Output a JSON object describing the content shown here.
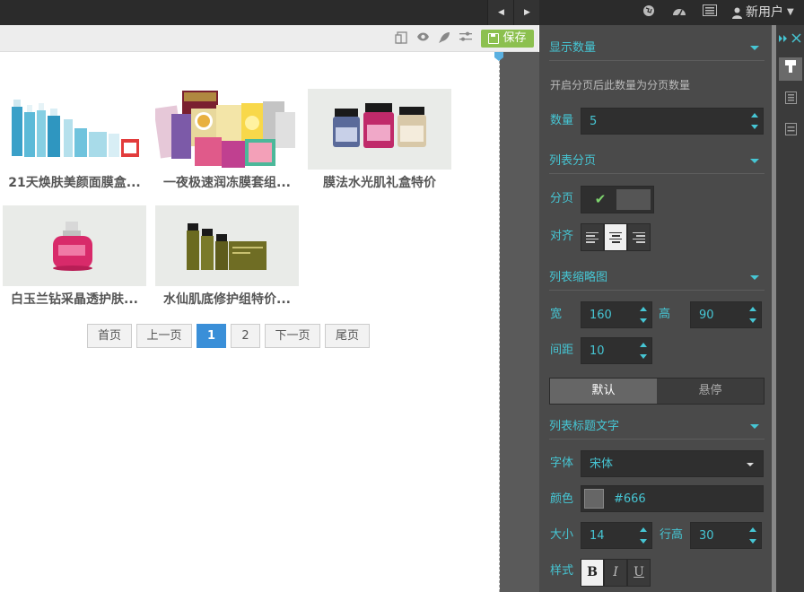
{
  "topbar": {
    "user_label": "新用户",
    "icons": [
      "globe-icon",
      "dashboard-icon",
      "list-icon",
      "user-icon"
    ]
  },
  "toolbar": {
    "icons": [
      "copy-icon",
      "preview-icon",
      "publish-icon",
      "settings-icon"
    ],
    "save_label": "保存"
  },
  "products": [
    {
      "title": "21天焕肤美颜面膜盒...",
      "image": "skincare-bottles-image"
    },
    {
      "title": "一夜极速润冻膜套组...",
      "image": "face-mask-packets-image"
    },
    {
      "title": "膜法水光肌礼盒特价",
      "image": "serum-jars-image"
    },
    {
      "title": "白玉兰钻采晶透护肤...",
      "image": "pink-perfume-bottle-image"
    },
    {
      "title": "水仙肌底修护组特价...",
      "image": "olive-skincare-set-image"
    }
  ],
  "pager": {
    "first": "首页",
    "prev": "上一页",
    "pages": [
      "1",
      "2"
    ],
    "current": "1",
    "next": "下一页",
    "last": "尾页"
  },
  "panel": {
    "display_count": {
      "header": "显示数量",
      "note": "开启分页后此数量为分页数量",
      "count_label": "数量",
      "count_value": "5"
    },
    "list_paging": {
      "header": "列表分页",
      "paging_label": "分页",
      "paging_enabled": true,
      "align_label": "对齐",
      "align_value": "center"
    },
    "thumbnail": {
      "header": "列表缩略图",
      "width_label": "宽",
      "width_value": "160",
      "height_label": "高",
      "height_value": "90",
      "spacing_label": "间距",
      "spacing_value": "10",
      "tabs": [
        "默认",
        "悬停"
      ],
      "active_tab": "默认"
    },
    "title_text": {
      "header": "列表标题文字",
      "font_label": "字体",
      "font_value": "宋体",
      "color_label": "颜色",
      "color_value": "#666",
      "size_label": "大小",
      "size_value": "14",
      "line_height_label": "行高",
      "line_height_value": "30",
      "style_label": "样式",
      "style_buttons": [
        "B",
        "I",
        "U"
      ],
      "bold_active": true
    }
  },
  "colors": {
    "accent": "#46c6d4",
    "save_green": "#8cc04f",
    "pager_active": "#3a8fd8",
    "panel_bg": "#4a4a4a"
  }
}
